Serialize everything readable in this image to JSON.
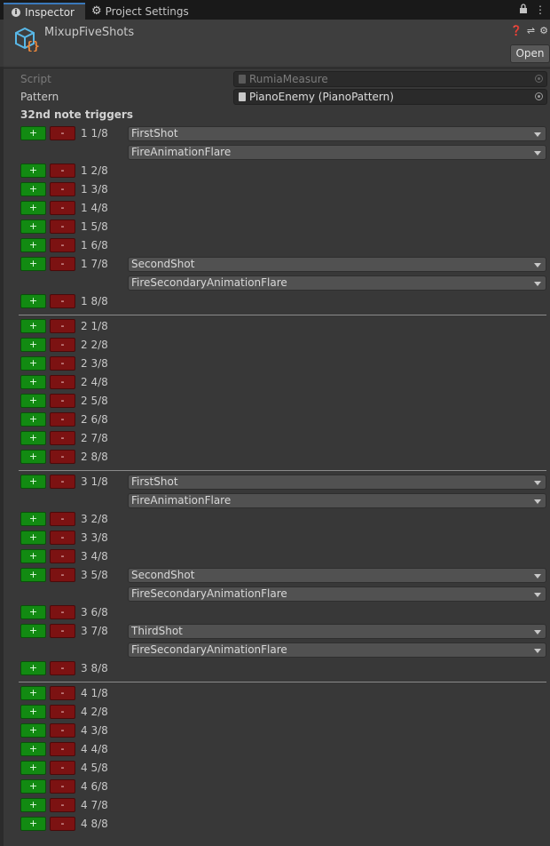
{
  "tabs": [
    {
      "label": "Inspector",
      "icon": "info-icon",
      "active": true
    },
    {
      "label": "Project Settings",
      "icon": "gear-icon",
      "active": false
    }
  ],
  "window_controls": {
    "lock": "lock-icon",
    "menu": "kebab-menu-icon"
  },
  "header": {
    "title": "MixupFiveShots",
    "icon": "scriptable-object-icon",
    "open_label": "Open",
    "icons": [
      "help-icon",
      "preset-sliders-icon",
      "settings-gear-icon"
    ]
  },
  "fields": {
    "script_label": "Script",
    "script_value": "RumiaMeasure",
    "pattern_label": "Pattern",
    "pattern_value": "PianoEnemy (PianoPattern)"
  },
  "section_label": "32nd note triggers",
  "buttons": {
    "plus": "+",
    "minus": "-"
  },
  "measures": [
    {
      "rows": [
        {
          "label": "1 1/8",
          "actions": [
            "FirstShot",
            "FireAnimationFlare"
          ]
        },
        {
          "label": "1 2/8",
          "actions": []
        },
        {
          "label": "1 3/8",
          "actions": []
        },
        {
          "label": "1 4/8",
          "actions": []
        },
        {
          "label": "1 5/8",
          "actions": []
        },
        {
          "label": "1 6/8",
          "actions": []
        },
        {
          "label": "1 7/8",
          "actions": [
            "SecondShot",
            "FireSecondaryAnimationFlare"
          ]
        },
        {
          "label": "1 8/8",
          "actions": []
        }
      ]
    },
    {
      "rows": [
        {
          "label": "2 1/8",
          "actions": []
        },
        {
          "label": "2 2/8",
          "actions": []
        },
        {
          "label": "2 3/8",
          "actions": []
        },
        {
          "label": "2 4/8",
          "actions": []
        },
        {
          "label": "2 5/8",
          "actions": []
        },
        {
          "label": "2 6/8",
          "actions": []
        },
        {
          "label": "2 7/8",
          "actions": []
        },
        {
          "label": "2 8/8",
          "actions": []
        }
      ]
    },
    {
      "rows": [
        {
          "label": "3 1/8",
          "actions": [
            "FirstShot",
            "FireAnimationFlare"
          ]
        },
        {
          "label": "3 2/8",
          "actions": []
        },
        {
          "label": "3 3/8",
          "actions": []
        },
        {
          "label": "3 4/8",
          "actions": []
        },
        {
          "label": "3 5/8",
          "actions": [
            "SecondShot",
            "FireSecondaryAnimationFlare"
          ]
        },
        {
          "label": "3 6/8",
          "actions": []
        },
        {
          "label": "3 7/8",
          "actions": [
            "ThirdShot",
            "FireSecondaryAnimationFlare"
          ]
        },
        {
          "label": "3 8/8",
          "actions": []
        }
      ]
    },
    {
      "rows": [
        {
          "label": "4 1/8",
          "actions": []
        },
        {
          "label": "4 2/8",
          "actions": []
        },
        {
          "label": "4 3/8",
          "actions": []
        },
        {
          "label": "4 4/8",
          "actions": []
        },
        {
          "label": "4 5/8",
          "actions": []
        },
        {
          "label": "4 6/8",
          "actions": []
        },
        {
          "label": "4 7/8",
          "actions": []
        },
        {
          "label": "4 8/8",
          "actions": []
        }
      ]
    }
  ]
}
